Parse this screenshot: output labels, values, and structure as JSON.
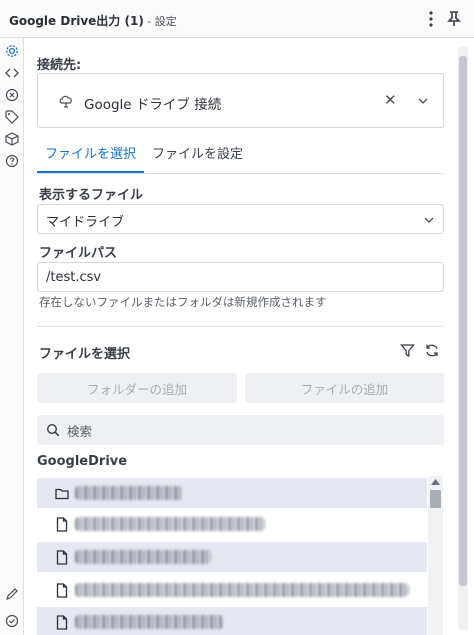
{
  "window": {
    "title": "Google Drive出力 (1)",
    "subtitle": " - 設定"
  },
  "connection": {
    "label": "接続先:",
    "value": "Google ドライブ 接続",
    "clear_glyph": "✕"
  },
  "tabs": [
    {
      "label": "ファイルを選択",
      "active": true
    },
    {
      "label": "ファイルを設定",
      "active": false
    }
  ],
  "files_to_show": {
    "label": "表示するファイル",
    "selected": "マイドライブ"
  },
  "file_path": {
    "label": "ファイルパス",
    "value": "/test.csv",
    "hint": "存在しないファイルまたはフォルダは新規作成されます"
  },
  "select_section": {
    "label": "ファイルを選択",
    "add_folder_label": "フォルダーの追加",
    "add_file_label": "ファイルの追加",
    "search_placeholder": "検索"
  },
  "tree": {
    "title": "GoogleDrive",
    "items": [
      {
        "type": "folder",
        "name": "",
        "shaded": true
      },
      {
        "type": "file",
        "name": "",
        "shaded": false
      },
      {
        "type": "file",
        "name": "",
        "shaded": true
      },
      {
        "type": "file",
        "name": "",
        "shaded": false
      },
      {
        "type": "file",
        "name": "",
        "shaded": true
      }
    ]
  },
  "colors": {
    "accent": "#1a73c9",
    "row_shade": "#e5e8f0",
    "disabled_button": "#eef0f3"
  }
}
